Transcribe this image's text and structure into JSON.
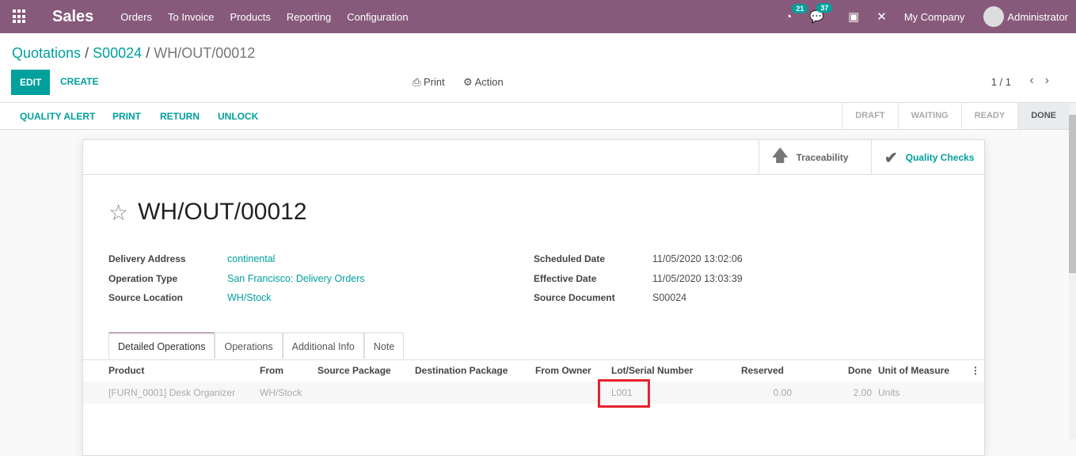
{
  "nav": {
    "brand": "Sales",
    "menu": [
      "Orders",
      "To Invoice",
      "Products",
      "Reporting",
      "Configuration"
    ],
    "activity_count": "21",
    "message_count": "37",
    "company": "My Company",
    "user": "Administrator"
  },
  "breadcrumb": {
    "b1": "Quotations",
    "sep": "/",
    "b2": "S00024",
    "current": "WH/OUT/00012"
  },
  "controls": {
    "edit": "EDIT",
    "create": "CREATE",
    "print": "Print",
    "action": "Action",
    "pager": "1 / 1"
  },
  "statusbar": {
    "actions": [
      "QUALITY ALERT",
      "PRINT",
      "RETURN",
      "UNLOCK"
    ],
    "stages": [
      "DRAFT",
      "WAITING",
      "READY",
      "DONE"
    ]
  },
  "smart": {
    "traceability": "Traceability",
    "quality": "Quality Checks"
  },
  "record": {
    "name": "WH/OUT/00012",
    "left": [
      {
        "label": "Delivery Address",
        "value": "continental"
      },
      {
        "label": "Operation Type",
        "value": "San Francisco: Delivery Orders"
      },
      {
        "label": "Source Location",
        "value": "WH/Stock"
      }
    ],
    "right": [
      {
        "label": "Scheduled Date",
        "value": "11/05/2020 13:02:06"
      },
      {
        "label": "Effective Date",
        "value": "11/05/2020 13:03:39"
      },
      {
        "label": "Source Document",
        "value": "S00024"
      }
    ]
  },
  "tabs": [
    "Detailed Operations",
    "Operations",
    "Additional Info",
    "Note"
  ],
  "table": {
    "headers": [
      "Product",
      "From",
      "Source Package",
      "Destination Package",
      "From Owner",
      "Lot/Serial Number",
      "Reserved",
      "Done",
      "Unit of Measure"
    ],
    "rows": [
      {
        "product": "[FURN_0001] Desk Organizer",
        "from": "WH/Stock",
        "lot": "L001",
        "reserved": "0.00",
        "done": "2.00",
        "uom": "Units"
      }
    ]
  }
}
